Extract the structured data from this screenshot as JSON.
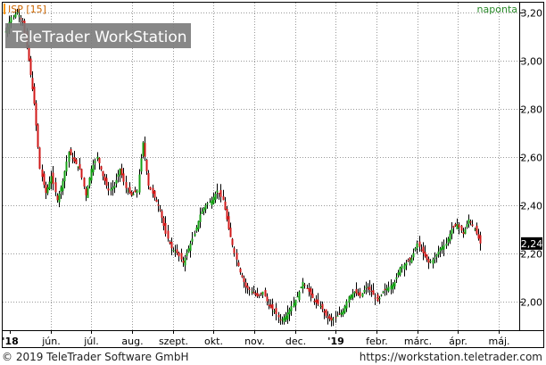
{
  "header": {
    "symbol_label": "ISP [15]",
    "watermark_text": "TeleTrader WorkStation",
    "interval_label": "naponta"
  },
  "footer": {
    "copyright": "© 2019 TeleTrader Software GmbH",
    "url": "https://workstation.teletrader.com"
  },
  "colors": {
    "up_candle": "#14a014",
    "down_candle": "#d01818",
    "wick": "#000000",
    "grid": "#999999",
    "axis_text": "#000000",
    "symbol_text": "#cc6600",
    "interval_text": "#2a8a2a",
    "accent_bar": "#ff9900",
    "last_price_bg": "#000000"
  },
  "chart_data": {
    "type": "candlestick",
    "ylim": [
      1.88,
      3.24
    ],
    "y_ticks": [
      "3,20",
      "3,00",
      "2,80",
      "2,60",
      "2,40",
      "2,20",
      "2,00"
    ],
    "y_tick_values": [
      3.2,
      3.0,
      2.8,
      2.6,
      2.4,
      2.2,
      2.0
    ],
    "x_labels": [
      "'18",
      "jún.",
      "júl.",
      "aug.",
      "szept.",
      "okt.",
      "nov.",
      "dec.",
      "'19",
      "febr.",
      "márc.",
      "ápr.",
      "máj."
    ],
    "last_price_label": "2,24",
    "last_price": 2.24,
    "closes": [
      3.12,
      3.18,
      3.2,
      3.16,
      3.0,
      2.82,
      2.55,
      2.45,
      2.52,
      2.42,
      2.5,
      2.62,
      2.58,
      2.55,
      2.44,
      2.55,
      2.6,
      2.52,
      2.46,
      2.48,
      2.55,
      2.47,
      2.44,
      2.46,
      2.66,
      2.48,
      2.43,
      2.38,
      2.28,
      2.22,
      2.2,
      2.16,
      2.22,
      2.28,
      2.36,
      2.4,
      2.42,
      2.46,
      2.42,
      2.3,
      2.2,
      2.12,
      2.06,
      2.04,
      2.02,
      2.04,
      1.98,
      1.96,
      1.92,
      1.94,
      1.98,
      2.02,
      2.08,
      2.04,
      2.0,
      1.98,
      1.94,
      1.92,
      1.94,
      1.96,
      2.02,
      2.04,
      2.02,
      2.06,
      2.04,
      2.0,
      2.04,
      2.06,
      2.08,
      2.14,
      2.16,
      2.18,
      2.24,
      2.2,
      2.16,
      2.18,
      2.22,
      2.24,
      2.3,
      2.32,
      2.28,
      2.34,
      2.3,
      2.24
    ]
  }
}
